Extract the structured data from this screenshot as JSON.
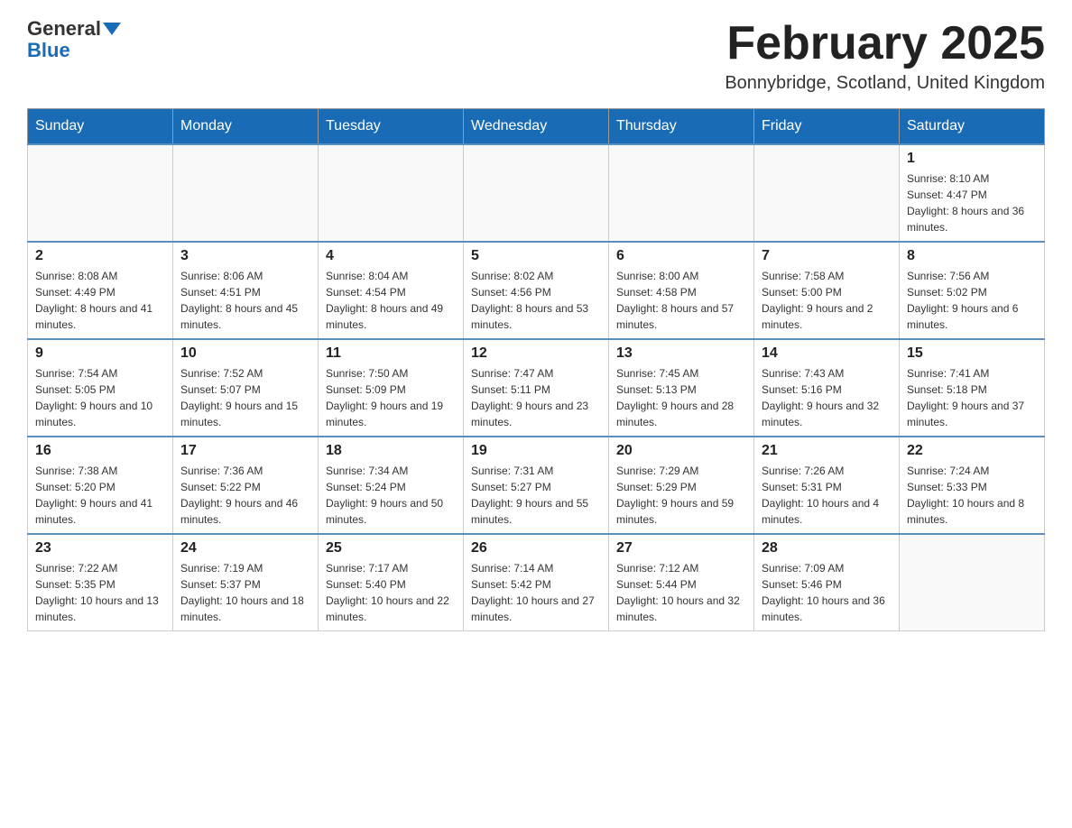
{
  "logo": {
    "text1": "General",
    "text2": "Blue"
  },
  "title": "February 2025",
  "location": "Bonnybridge, Scotland, United Kingdom",
  "days_of_week": [
    "Sunday",
    "Monday",
    "Tuesday",
    "Wednesday",
    "Thursday",
    "Friday",
    "Saturday"
  ],
  "weeks": [
    [
      {
        "day": "",
        "info": ""
      },
      {
        "day": "",
        "info": ""
      },
      {
        "day": "",
        "info": ""
      },
      {
        "day": "",
        "info": ""
      },
      {
        "day": "",
        "info": ""
      },
      {
        "day": "",
        "info": ""
      },
      {
        "day": "1",
        "info": "Sunrise: 8:10 AM\nSunset: 4:47 PM\nDaylight: 8 hours and 36 minutes."
      }
    ],
    [
      {
        "day": "2",
        "info": "Sunrise: 8:08 AM\nSunset: 4:49 PM\nDaylight: 8 hours and 41 minutes."
      },
      {
        "day": "3",
        "info": "Sunrise: 8:06 AM\nSunset: 4:51 PM\nDaylight: 8 hours and 45 minutes."
      },
      {
        "day": "4",
        "info": "Sunrise: 8:04 AM\nSunset: 4:54 PM\nDaylight: 8 hours and 49 minutes."
      },
      {
        "day": "5",
        "info": "Sunrise: 8:02 AM\nSunset: 4:56 PM\nDaylight: 8 hours and 53 minutes."
      },
      {
        "day": "6",
        "info": "Sunrise: 8:00 AM\nSunset: 4:58 PM\nDaylight: 8 hours and 57 minutes."
      },
      {
        "day": "7",
        "info": "Sunrise: 7:58 AM\nSunset: 5:00 PM\nDaylight: 9 hours and 2 minutes."
      },
      {
        "day": "8",
        "info": "Sunrise: 7:56 AM\nSunset: 5:02 PM\nDaylight: 9 hours and 6 minutes."
      }
    ],
    [
      {
        "day": "9",
        "info": "Sunrise: 7:54 AM\nSunset: 5:05 PM\nDaylight: 9 hours and 10 minutes."
      },
      {
        "day": "10",
        "info": "Sunrise: 7:52 AM\nSunset: 5:07 PM\nDaylight: 9 hours and 15 minutes."
      },
      {
        "day": "11",
        "info": "Sunrise: 7:50 AM\nSunset: 5:09 PM\nDaylight: 9 hours and 19 minutes."
      },
      {
        "day": "12",
        "info": "Sunrise: 7:47 AM\nSunset: 5:11 PM\nDaylight: 9 hours and 23 minutes."
      },
      {
        "day": "13",
        "info": "Sunrise: 7:45 AM\nSunset: 5:13 PM\nDaylight: 9 hours and 28 minutes."
      },
      {
        "day": "14",
        "info": "Sunrise: 7:43 AM\nSunset: 5:16 PM\nDaylight: 9 hours and 32 minutes."
      },
      {
        "day": "15",
        "info": "Sunrise: 7:41 AM\nSunset: 5:18 PM\nDaylight: 9 hours and 37 minutes."
      }
    ],
    [
      {
        "day": "16",
        "info": "Sunrise: 7:38 AM\nSunset: 5:20 PM\nDaylight: 9 hours and 41 minutes."
      },
      {
        "day": "17",
        "info": "Sunrise: 7:36 AM\nSunset: 5:22 PM\nDaylight: 9 hours and 46 minutes."
      },
      {
        "day": "18",
        "info": "Sunrise: 7:34 AM\nSunset: 5:24 PM\nDaylight: 9 hours and 50 minutes."
      },
      {
        "day": "19",
        "info": "Sunrise: 7:31 AM\nSunset: 5:27 PM\nDaylight: 9 hours and 55 minutes."
      },
      {
        "day": "20",
        "info": "Sunrise: 7:29 AM\nSunset: 5:29 PM\nDaylight: 9 hours and 59 minutes."
      },
      {
        "day": "21",
        "info": "Sunrise: 7:26 AM\nSunset: 5:31 PM\nDaylight: 10 hours and 4 minutes."
      },
      {
        "day": "22",
        "info": "Sunrise: 7:24 AM\nSunset: 5:33 PM\nDaylight: 10 hours and 8 minutes."
      }
    ],
    [
      {
        "day": "23",
        "info": "Sunrise: 7:22 AM\nSunset: 5:35 PM\nDaylight: 10 hours and 13 minutes."
      },
      {
        "day": "24",
        "info": "Sunrise: 7:19 AM\nSunset: 5:37 PM\nDaylight: 10 hours and 18 minutes."
      },
      {
        "day": "25",
        "info": "Sunrise: 7:17 AM\nSunset: 5:40 PM\nDaylight: 10 hours and 22 minutes."
      },
      {
        "day": "26",
        "info": "Sunrise: 7:14 AM\nSunset: 5:42 PM\nDaylight: 10 hours and 27 minutes."
      },
      {
        "day": "27",
        "info": "Sunrise: 7:12 AM\nSunset: 5:44 PM\nDaylight: 10 hours and 32 minutes."
      },
      {
        "day": "28",
        "info": "Sunrise: 7:09 AM\nSunset: 5:46 PM\nDaylight: 10 hours and 36 minutes."
      },
      {
        "day": "",
        "info": ""
      }
    ]
  ]
}
